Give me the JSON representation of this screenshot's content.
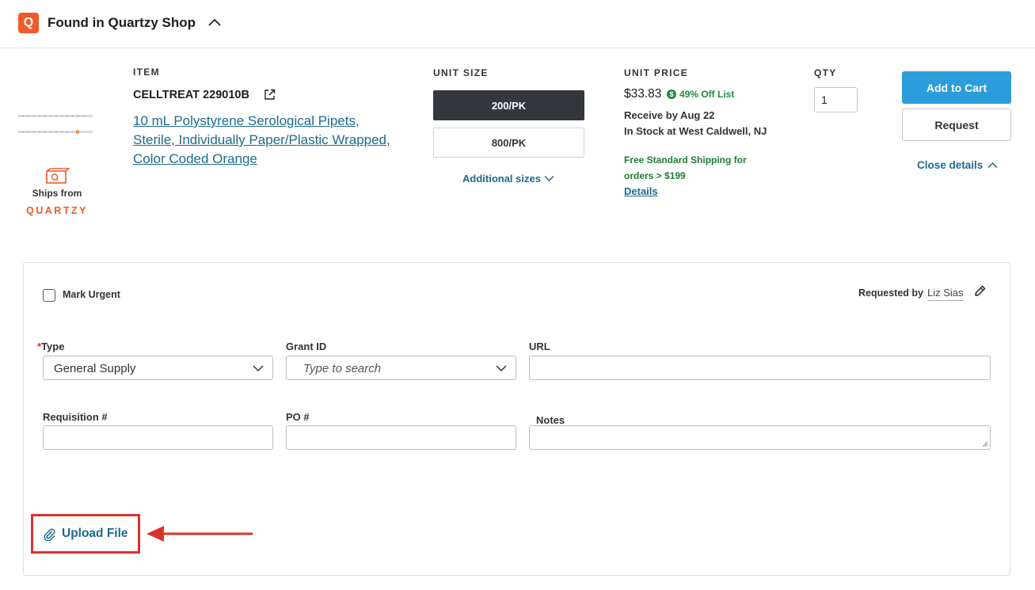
{
  "header": {
    "logo_letter": "Q",
    "title": "Found in Quartzy Shop"
  },
  "product": {
    "ships_from": "Ships from",
    "ships_brand": "QUARTZY",
    "item_label": "ITEM",
    "item_code": "CELLTREAT 229010B",
    "item_name": "10 mL Polystyrene Serological Pipets, Sterile, Individually Paper/Plastic Wrapped, Color Coded Orange",
    "unit_size_label": "UNIT SIZE",
    "sizes": [
      "200/PK",
      "800/PK"
    ],
    "selected_size": "200/PK",
    "additional_sizes": "Additional sizes",
    "unit_price_label": "UNIT PRICE",
    "price": "$33.83",
    "discount_symbol": "$",
    "discount": "49% Off List",
    "receive_by": "Receive by Aug 22",
    "in_stock": "In Stock at West Caldwell, NJ",
    "free_shipping": "Free Standard Shipping for orders > $199",
    "details": "Details",
    "qty_label": "QTY",
    "qty_value": "1",
    "add_to_cart": "Add to Cart",
    "request": "Request",
    "close_details": "Close details"
  },
  "form": {
    "mark_urgent": "Mark Urgent",
    "requested_by_label": "Requested by",
    "requested_by_name": "Liz Sias",
    "type_required_mark": "*",
    "type_label": "Type",
    "type_value": "General Supply",
    "grant_label": "Grant ID",
    "grant_placeholder": "Type to search",
    "url_label": "URL",
    "url_value": "",
    "requisition_label": "Requisition #",
    "requisition_value": "",
    "po_label": "PO #",
    "po_value": "",
    "notes_label": "Notes",
    "notes_value": "",
    "upload_file": "Upload File"
  },
  "colors": {
    "brand_orange": "#f05a28",
    "link_blue": "#1d6a8b",
    "button_blue": "#2b9ddb",
    "highlight_red": "#d9342b",
    "green": "#1e8a3b"
  }
}
